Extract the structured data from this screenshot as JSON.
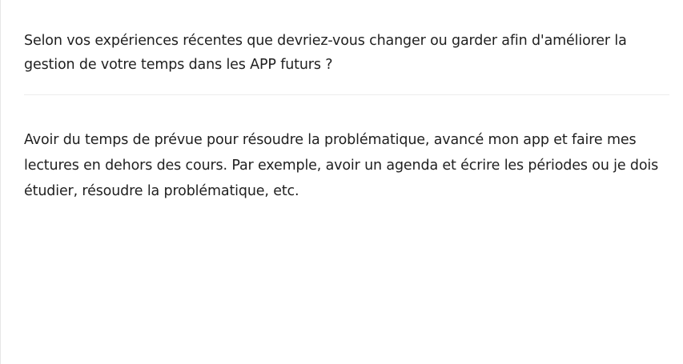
{
  "question": {
    "text": "Selon vos expériences récentes que devriez-vous changer ou garder afin d'améliorer la gestion de votre temps dans les APP futurs ?"
  },
  "answer": {
    "text": "Avoir du temps de prévue pour résoudre la problématique, avancé mon app et faire mes lectures en dehors des cours. Par exemple, avoir un agenda et écrire les périodes ou je dois étudier, résoudre la problématique, etc."
  }
}
